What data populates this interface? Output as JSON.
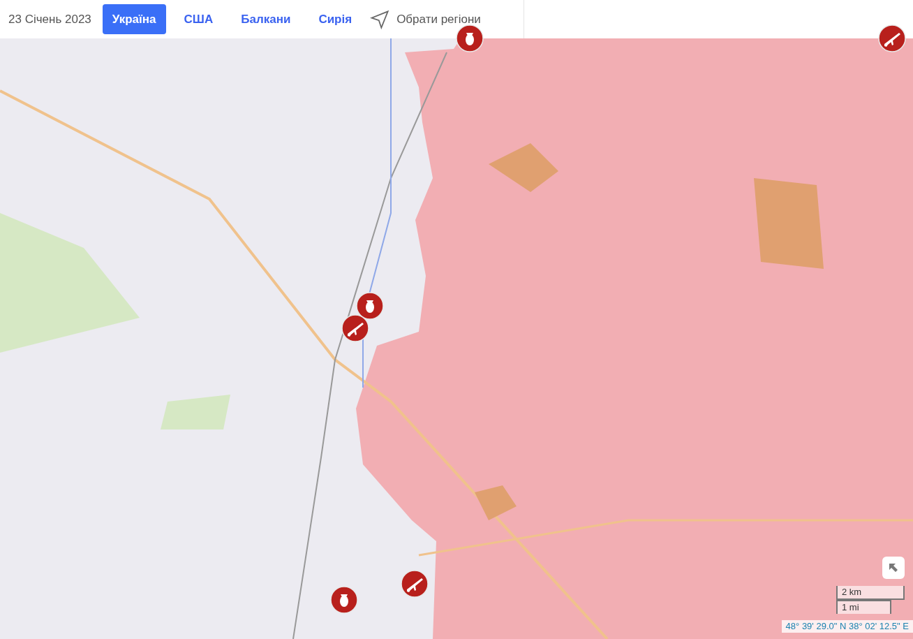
{
  "header": {
    "date": "23 Січень 2023",
    "tabs": [
      {
        "label": "Україна",
        "selected": true
      },
      {
        "label": "США",
        "selected": false
      },
      {
        "label": "Балкани",
        "selected": false
      },
      {
        "label": "Сирія",
        "selected": false
      }
    ],
    "region_button": "Обрати регіони"
  },
  "map": {
    "markers": [
      {
        "kind": "bomb"
      },
      {
        "kind": "rifle"
      },
      {
        "kind": "bomb"
      },
      {
        "kind": "rifle"
      },
      {
        "kind": "rifle"
      },
      {
        "kind": "bomb"
      }
    ],
    "scale": [
      "2 km",
      "1 mi"
    ],
    "coordinates": "48° 39' 29.0\" N 38° 02' 12.5\" E"
  }
}
